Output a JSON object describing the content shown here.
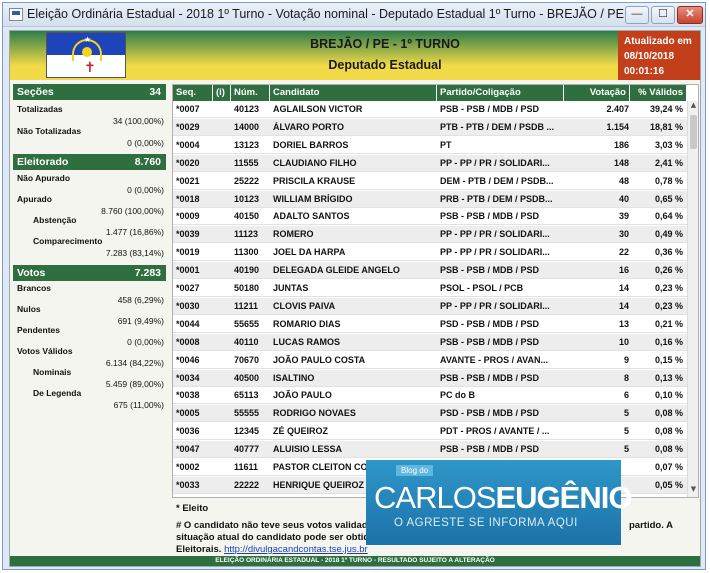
{
  "window": {
    "title": "Eleição Ordinária Estadual - 2018 1º Turno - Votação nominal - Deputado Estadual 1º Turno - BREJÃO / PE",
    "min_glyph": "—",
    "max_glyph": "☐",
    "close_glyph": "✕"
  },
  "header": {
    "title": "BREJÃO / PE - 1º TURNO",
    "subtitle": "Deputado Estadual",
    "updated_label": "Atualizado em",
    "updated_date": "08/10/2018",
    "updated_time": "00:01:16"
  },
  "sidebar": {
    "secoes": {
      "label": "Seções",
      "value": "34",
      "totalizadas_label": "Totalizadas",
      "totalizadas_value": "34 (100,00%)",
      "nao_totalizadas_label": "Não Totalizadas",
      "nao_totalizadas_value": "0 (0,00%)"
    },
    "eleitorado": {
      "label": "Eleitorado",
      "value": "8.760",
      "nao_apurado_label": "Não Apurado",
      "nao_apurado_value": "0 (0,00%)",
      "apurado_label": "Apurado",
      "apurado_value": "8.760 (100,00%)",
      "abstencao_label": "Abstenção",
      "abstencao_value": "1.477 (16,86%)",
      "comparecimento_label": "Comparecimento",
      "comparecimento_value": "7.283 (83,14%)"
    },
    "votos": {
      "label": "Votos",
      "value": "7.283",
      "brancos_label": "Brancos",
      "brancos_value": "458 (6,29%)",
      "nulos_label": "Nulos",
      "nulos_value": "691 (9,49%)",
      "pendentes_label": "Pendentes",
      "pendentes_value": "0 (0,00%)",
      "validos_label": "Votos Válidos",
      "validos_value": "6.134 (84,22%)",
      "nominais_label": "Nominais",
      "nominais_value": "5.459 (89,00%)",
      "legenda_label": "De Legenda",
      "legenda_value": "675 (11,00%)"
    }
  },
  "table": {
    "headers": [
      "Seq.",
      "(i)",
      "Núm.",
      "Candidato",
      "Partido/Coligação",
      "Votação",
      "% Válidos"
    ],
    "rows": [
      {
        "seq": "*0007",
        "num": "40123",
        "cand": "AGLAILSON VICTOR",
        "part": "PSB - PSB / MDB / PSD",
        "vot": "2.407",
        "pct": "39,24 %"
      },
      {
        "seq": "*0029",
        "num": "14000",
        "cand": "ÁLVARO PORTO",
        "part": "PTB - PTB / DEM / PSDB ...",
        "vot": "1.154",
        "pct": "18,81 %"
      },
      {
        "seq": "*0004",
        "num": "13123",
        "cand": "DORIEL BARROS",
        "part": "PT",
        "vot": "186",
        "pct": "3,03 %"
      },
      {
        "seq": "*0020",
        "num": "11555",
        "cand": "CLAUDIANO FILHO",
        "part": "PP - PP / PR / SOLIDARI...",
        "vot": "148",
        "pct": "2,41 %"
      },
      {
        "seq": "*0021",
        "num": "25222",
        "cand": "PRISCILA KRAUSE",
        "part": "DEM - PTB / DEM / PSDB...",
        "vot": "48",
        "pct": "0,78 %"
      },
      {
        "seq": "*0018",
        "num": "10123",
        "cand": "WILLIAM BRÍGIDO",
        "part": "PRB - PTB / DEM / PSDB...",
        "vot": "40",
        "pct": "0,65 %"
      },
      {
        "seq": "*0009",
        "num": "40150",
        "cand": "ADALTO SANTOS",
        "part": "PSB - PSB / MDB / PSD",
        "vot": "39",
        "pct": "0,64 %"
      },
      {
        "seq": "*0039",
        "num": "11123",
        "cand": "ROMERO",
        "part": "PP - PP / PR / SOLIDARI...",
        "vot": "30",
        "pct": "0,49 %"
      },
      {
        "seq": "*0019",
        "num": "11300",
        "cand": "JOEL DA HARPA",
        "part": "PP - PP / PR / SOLIDARI...",
        "vot": "22",
        "pct": "0,36 %"
      },
      {
        "seq": "*0001",
        "num": "40190",
        "cand": "DELEGADA GLEIDE ANGELO",
        "part": "PSB - PSB / MDB / PSD",
        "vot": "16",
        "pct": "0,26 %"
      },
      {
        "seq": "*0027",
        "num": "50180",
        "cand": "JUNTAS",
        "part": "PSOL - PSOL / PCB",
        "vot": "14",
        "pct": "0,23 %"
      },
      {
        "seq": "*0030",
        "num": "11211",
        "cand": "CLOVIS PAIVA",
        "part": "PP - PP / PR / SOLIDARI...",
        "vot": "14",
        "pct": "0,23 %"
      },
      {
        "seq": "*0044",
        "num": "55655",
        "cand": "ROMARIO DIAS",
        "part": "PSD - PSB / MDB / PSD",
        "vot": "13",
        "pct": "0,21 %"
      },
      {
        "seq": "*0008",
        "num": "40110",
        "cand": "LUCAS RAMOS",
        "part": "PSB - PSB / MDB / PSD",
        "vot": "10",
        "pct": "0,16 %"
      },
      {
        "seq": "*0046",
        "num": "70670",
        "cand": "JOÃO PAULO COSTA",
        "part": "AVANTE - PROS / AVAN...",
        "vot": "9",
        "pct": "0,15 %"
      },
      {
        "seq": "*0034",
        "num": "40500",
        "cand": "ISALTINO",
        "part": "PSB - PSB / MDB / PSD",
        "vot": "8",
        "pct": "0,13 %"
      },
      {
        "seq": "*0038",
        "num": "65113",
        "cand": "JOÃO PAULO",
        "part": "PC do B",
        "vot": "6",
        "pct": "0,10 %"
      },
      {
        "seq": "*0005",
        "num": "55555",
        "cand": "RODRIGO NOVAES",
        "part": "PSD - PSB / MDB / PSD",
        "vot": "5",
        "pct": "0,08 %"
      },
      {
        "seq": "*0036",
        "num": "12345",
        "cand": "ZÉ QUEIROZ",
        "part": "PDT - PROS / AVANTE / ...",
        "vot": "5",
        "pct": "0,08 %"
      },
      {
        "seq": "*0047",
        "num": "40777",
        "cand": "ALUISIO LESSA",
        "part": "PSB - PSB / MDB / PSD",
        "vot": "5",
        "pct": "0,08 %"
      },
      {
        "seq": "*0002",
        "num": "11611",
        "cand": "PASTOR CLEITON CO",
        "part": "",
        "vot": "",
        "pct": "0,07 %"
      },
      {
        "seq": "*0033",
        "num": "22222",
        "cand": "HENRIQUE QUEIROZ",
        "part": "",
        "vot": "",
        "pct": "0,05 %"
      }
    ]
  },
  "notes": {
    "eleito": "* Eleito",
    "line2a": "# O candidato não teve seus votos validado",
    "line2b": "partido. A",
    "line3": "situação atual do candidato pode ser obtida",
    "line4": "Eleitorais.",
    "link": "http://divulgacandcontas.tse.jus.br"
  },
  "footer": "ELEIÇÃO ORDINÁRIA ESTADUAL - 2018 1º TURNO - RESULTADO SUJEITO A ALTERAÇÃO",
  "blog": {
    "small": "Blog do",
    "name_a": "CARLOS",
    "name_b": "EUGÊNIO",
    "tag": "O AGRESTE SE INFORMA AQUI"
  }
}
